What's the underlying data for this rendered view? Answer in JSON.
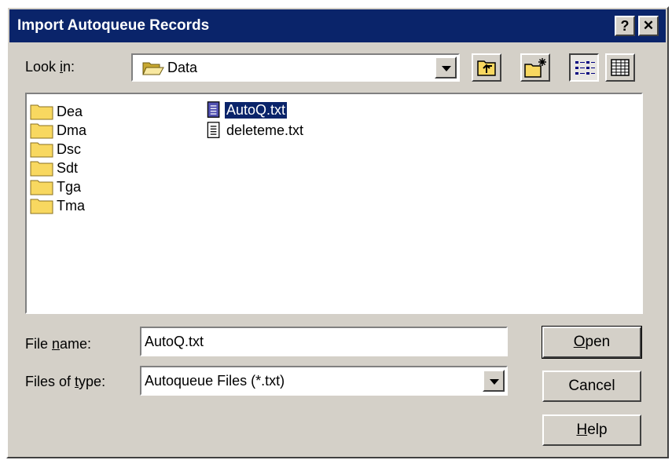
{
  "window": {
    "title": "Import Autoqueue Records",
    "help_button": "?",
    "close_button": "✕"
  },
  "look_in": {
    "label_pre": "Look ",
    "label_accel": "i",
    "label_post": "n:",
    "value": "Data"
  },
  "toolbar": {
    "icons": [
      "up-one-level-icon",
      "new-folder-icon",
      "list-view-icon",
      "details-view-icon"
    ]
  },
  "files": {
    "folders": [
      "Dea",
      "Dma",
      "Dsc",
      "Sdt",
      "Tga",
      "Tma"
    ],
    "documents": [
      {
        "name": "AutoQ.txt",
        "selected": true
      },
      {
        "name": "deleteme.txt",
        "selected": false
      }
    ]
  },
  "file_name": {
    "label_pre": "File ",
    "label_accel": "n",
    "label_post": "ame:",
    "value": "AutoQ.txt"
  },
  "file_type": {
    "label_pre": "Files of ",
    "label_accel": "t",
    "label_post": "ype:",
    "value": "Autoqueue Files (*.txt)"
  },
  "buttons": {
    "open_accel": "O",
    "open_rest": "pen",
    "cancel": "Cancel",
    "help_accel": "H",
    "help_rest": "elp"
  },
  "colors": {
    "title_bar": "#0a246a",
    "dialog_face": "#d4d0c8",
    "selection": "#0a246a",
    "folder_yellow": "#f8d860"
  }
}
